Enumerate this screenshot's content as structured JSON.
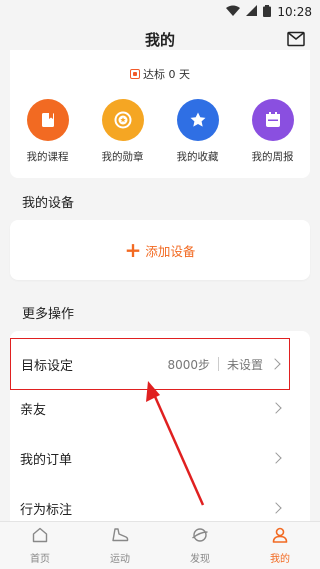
{
  "status": {
    "time": "10:28"
  },
  "header": {
    "title": "我的"
  },
  "goal_line": {
    "text": "达标 0 天"
  },
  "features": [
    {
      "label": "我的课程",
      "color": "#f26a22",
      "icon": "course-icon"
    },
    {
      "label": "我的勋章",
      "color": "#f5a623",
      "icon": "medal-icon"
    },
    {
      "label": "我的收藏",
      "color": "#2f6fe4",
      "icon": "star-icon"
    },
    {
      "label": "我的周报",
      "color": "#8a4fe0",
      "icon": "calendar-icon"
    }
  ],
  "devices": {
    "title": "我的设备",
    "add_label": "添加设备"
  },
  "more": {
    "title": "更多操作",
    "items": [
      {
        "label": "目标设定",
        "value": "8000步",
        "status": "未设置"
      },
      {
        "label": "亲友"
      },
      {
        "label": "我的订单"
      },
      {
        "label": "行为标注"
      }
    ]
  },
  "tabs": [
    {
      "label": "首页",
      "active": false
    },
    {
      "label": "运动",
      "active": false
    },
    {
      "label": "发现",
      "active": false
    },
    {
      "label": "我的",
      "active": true
    }
  ],
  "colors": {
    "accent": "#f26a22",
    "highlight": "#e02020"
  }
}
